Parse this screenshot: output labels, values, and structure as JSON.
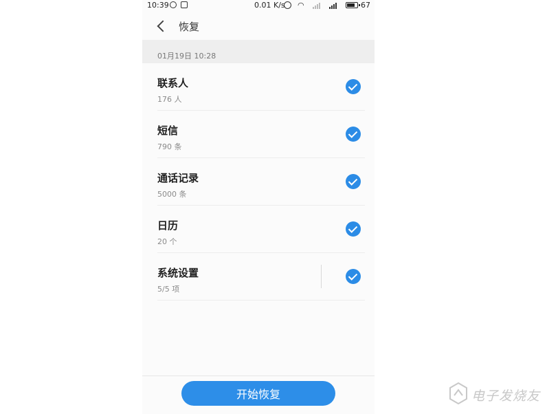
{
  "status_bar": {
    "time": "10:39",
    "speed": "0.01 K/s",
    "battery": "67"
  },
  "header": {
    "title": "恢复"
  },
  "backup_date": "01月19日 10:28",
  "items": [
    {
      "title": "联系人",
      "subtitle": "176 人",
      "checked": true
    },
    {
      "title": "短信",
      "subtitle": "790 条",
      "checked": true
    },
    {
      "title": "通话记录",
      "subtitle": "5000 条",
      "checked": true
    },
    {
      "title": "日历",
      "subtitle": "20 个",
      "checked": true
    },
    {
      "title": "系统设置",
      "subtitle": "5/5 项",
      "checked": true
    }
  ],
  "start_button_label": "开始恢复",
  "watermark": "电子发烧友",
  "colors": {
    "accent": "#2d8ee8",
    "check": "#2c8ce6",
    "band": "#eeeeee"
  },
  "icons": [
    "back-icon",
    "check-icon",
    "wifi-icon",
    "alarm-icon",
    "battery-icon",
    "signal-icon"
  ]
}
